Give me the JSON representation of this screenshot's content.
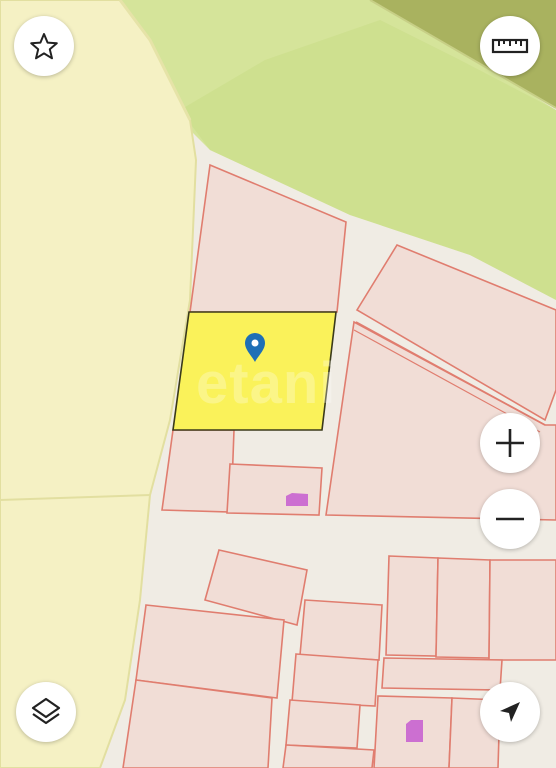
{
  "map": {
    "watermark_text": "etani",
    "colors": {
      "background": "#f0ece4",
      "forest_light": "#d8e59a",
      "forest_mid": "#c9de86",
      "forest_dark": "#a8b05f",
      "field": "#f5f1c4",
      "field_border": "#e2dfa0",
      "parcel_fill": "#f1ddd6",
      "parcel_stroke": "#e07d6f",
      "selected_parcel_fill": "#faf25a",
      "selected_parcel_stroke": "#3a3a1a",
      "building": "#cc6fd1",
      "pin": "#1e6fb6"
    },
    "selected_parcel": {
      "highlighted": true
    }
  },
  "controls": {
    "favorite": "star-icon",
    "ruler": "ruler-icon",
    "zoom_in": "plus-icon",
    "zoom_out": "minus-icon",
    "layers": "layers-icon",
    "locate": "navigation-arrow-icon"
  }
}
